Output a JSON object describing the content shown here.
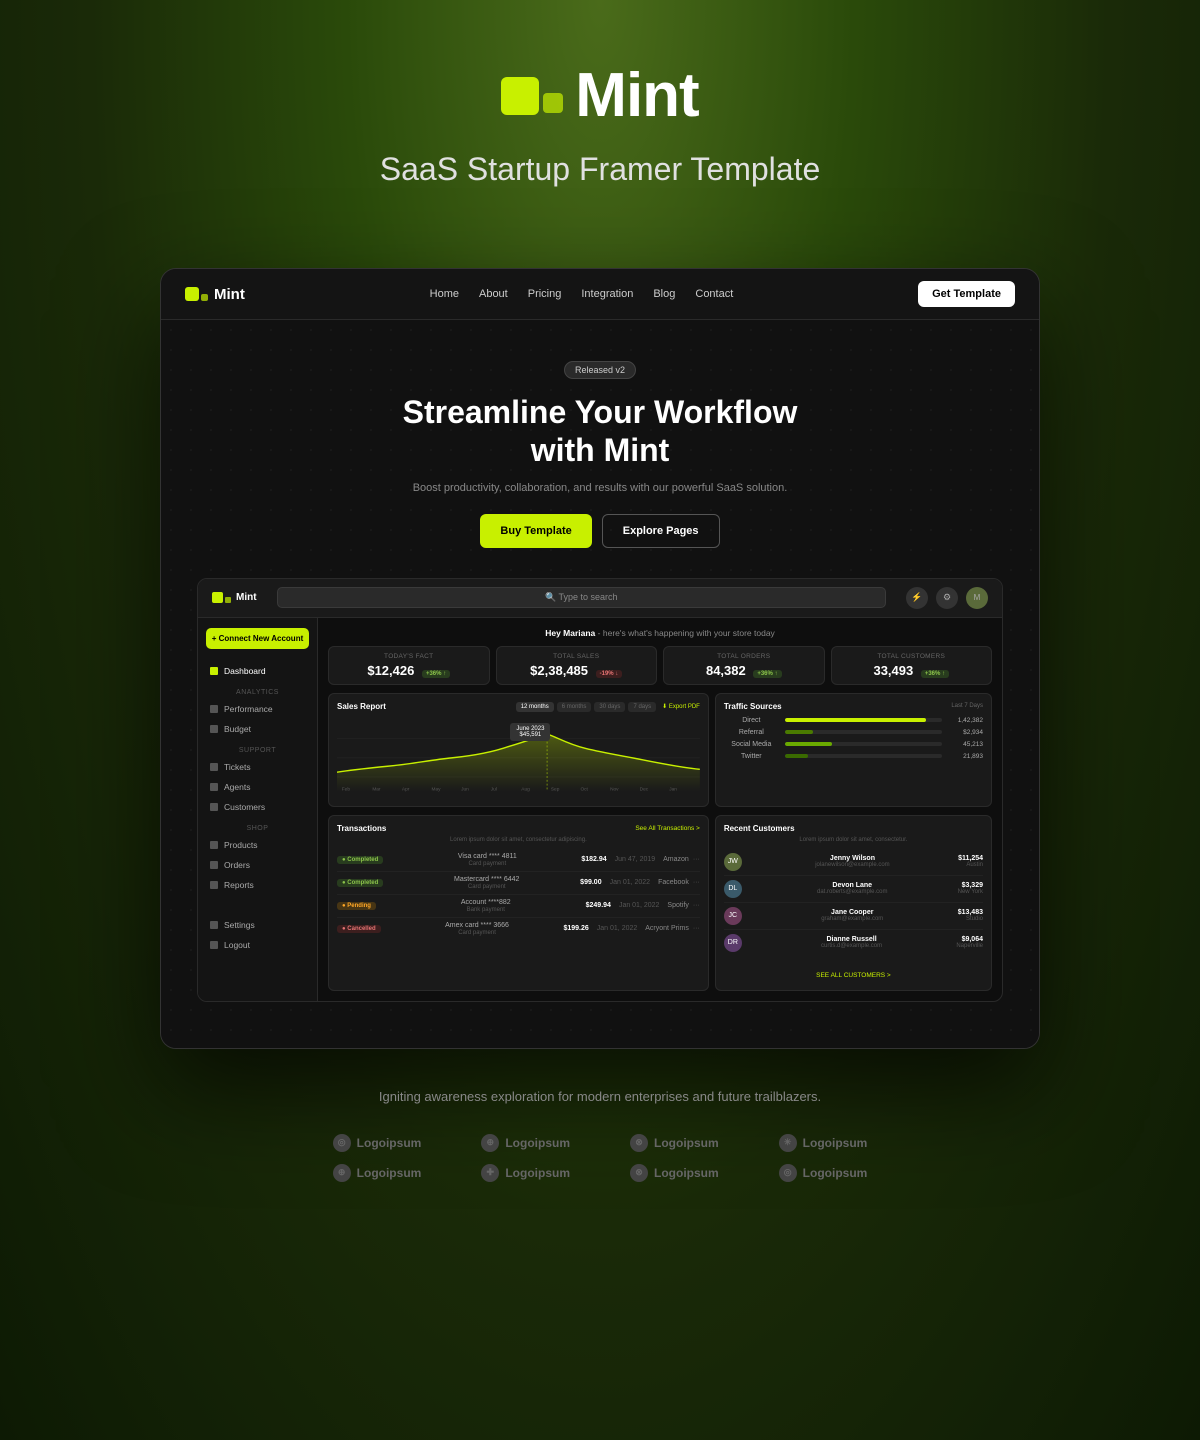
{
  "page": {
    "background": "#1a2a08"
  },
  "header": {
    "logo_text": "Mint",
    "subtitle": "SaaS Startup Framer Template"
  },
  "nav": {
    "brand": "Mint",
    "links": [
      "Home",
      "About",
      "Pricing",
      "Integration",
      "Blog",
      "Contact"
    ],
    "cta_label": "Get Template"
  },
  "hero": {
    "badge": "Released v2",
    "title": "Streamline Your Workflow\nwith Mint",
    "subtitle": "Boost productivity, collaboration, and results with our powerful SaaS solution.",
    "btn_buy": "Buy Template",
    "btn_explore": "Explore Pages"
  },
  "dashboard": {
    "greeting": "Hey Mariana - here's what's happening with your store today",
    "search_placeholder": "Type to search",
    "stats": [
      {
        "label": "TODAY'S FACT",
        "value": "$12,426",
        "badge": "+36%",
        "trend": "green"
      },
      {
        "label": "TOTAL SALES",
        "value": "$2,38,485",
        "badge": "+19%",
        "trend": "red"
      },
      {
        "label": "TOTAL ORDERS",
        "value": "84,382",
        "badge": "+36%",
        "trend": "green"
      },
      {
        "label": "TOTAL CUSTOMERS",
        "value": "33,493",
        "badge": "+36%",
        "trend": "green"
      }
    ],
    "sidebar": {
      "connect_btn": "+ Connect New Account",
      "nav_items": [
        {
          "label": "Dashboard",
          "section": null
        },
        {
          "label": "Performance",
          "section": "ANALYTICS"
        },
        {
          "label": "Budget",
          "section": null
        },
        {
          "label": "Tickets",
          "section": "SUPPORT"
        },
        {
          "label": "Agents",
          "section": null
        },
        {
          "label": "Customers",
          "section": null
        },
        {
          "label": "Products",
          "section": "SHOP"
        },
        {
          "label": "Orders",
          "section": null
        },
        {
          "label": "Reports",
          "section": null
        },
        {
          "label": "Settings",
          "section": null
        },
        {
          "label": "Logout",
          "section": null
        }
      ]
    },
    "sales_report": {
      "title": "Sales Report",
      "tabs": [
        "12 months",
        "6 months",
        "30 days",
        "7 days"
      ],
      "active_tab": "12 months",
      "export_label": "Export PDF",
      "tooltip_month": "June 2023",
      "tooltip_value": "$45,591"
    },
    "traffic_sources": {
      "title": "Traffic Sources",
      "period": "Last 7 Days",
      "sources": [
        {
          "label": "Direct",
          "value": "1,42,382",
          "pct": 90
        },
        {
          "label": "Referral",
          "value": "$2,934",
          "pct": 18
        },
        {
          "label": "Social Media",
          "value": "45,213",
          "pct": 30
        },
        {
          "label": "Twitter",
          "value": "21,893",
          "pct": 15
        }
      ]
    },
    "transactions": {
      "title": "Transactions",
      "desc": "Lorem ipsum dolor sit amet, consectetur adipiscing.",
      "see_all": "See All Transactions >",
      "rows": [
        {
          "status": "Completed",
          "info": "Visa card **** 4811",
          "sub": "Card payment",
          "amount": "$182.94",
          "date": "Jun 47, 2019",
          "merchant": "Amazon"
        },
        {
          "status": "Completed",
          "info": "Mastercard **** 6442",
          "sub": "Card payment",
          "amount": "$99.00",
          "date": "Jan 01, 2022",
          "merchant": "Facebook"
        },
        {
          "status": "Pending",
          "info": "Account ****882",
          "sub": "Bank payment",
          "amount": "$249.94",
          "date": "Jan 01, 2022",
          "merchant": "Spotify"
        },
        {
          "status": "Cancelled",
          "info": "Amex card **** 3666",
          "sub": "Card payment",
          "amount": "$199.26",
          "date": "Jan 01, 2022",
          "merchant": "Acryont Prims"
        }
      ]
    },
    "recent_customers": {
      "title": "Recent Customers",
      "desc": "Lorem ipsum dolor sit amet, consectetur.",
      "see_all": "SEE ALL CUSTOMERS >",
      "customers": [
        {
          "name": "Jenny Wilson",
          "email": "jolanewilson@example.com",
          "amount": "$11,254",
          "location": "Austin",
          "initials": "JW",
          "color": "#5a6a3a"
        },
        {
          "name": "Devon Lane",
          "email": "dat.roberts@example.com",
          "amount": "$3,329",
          "location": "New York",
          "initials": "DL",
          "color": "#3a5a6a"
        },
        {
          "name": "Jane Cooper",
          "email": "graham@example.com",
          "amount": "$13,483",
          "location": "Studio",
          "initials": "JC",
          "color": "#6a3a5a"
        },
        {
          "name": "Dianne Russell",
          "email": "curtis.d@example.com",
          "amount": "$9,064",
          "location": "Naperville",
          "initials": "DR",
          "color": "#5a3a6a"
        }
      ]
    }
  },
  "footer": {
    "tagline": "Igniting awareness exploration for modern enterprises and future trailblazers.",
    "logos": [
      [
        "Logoipsum",
        "Logoipsum",
        "Logoipsum",
        "Logoipsum"
      ],
      [
        "Logoipsum",
        "Logoipsum",
        "Logoipsum",
        "Logoipsum"
      ]
    ]
  }
}
